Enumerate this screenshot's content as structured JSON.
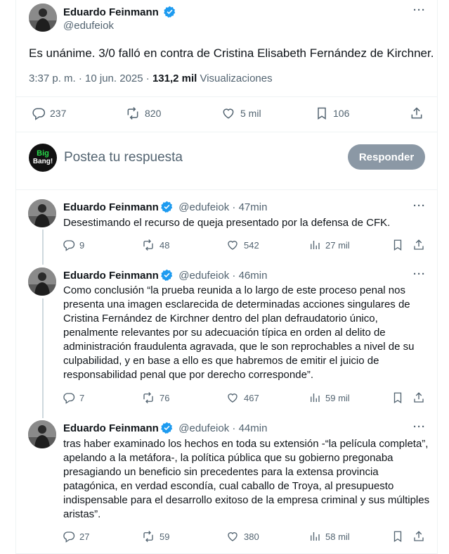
{
  "main_tweet": {
    "name": "Eduardo Feinmann",
    "handle": "@edufeiok",
    "text": "Es unánime. 3/0 falló en contra de Cristina Elisabeth Fernández de Kirchner.",
    "time": "3:37 p. m. · 10 jun. 2025 · ",
    "views_count": "131,2 mil",
    "views_label": " Visualizaciones",
    "replies": "237",
    "reposts": "820",
    "likes": "5 mil",
    "bookmarks": "106"
  },
  "composer": {
    "avatar_line1": "Big",
    "avatar_line2": "Bang!",
    "placeholder": "Postea tu respuesta",
    "button": "Responder"
  },
  "replies": [
    {
      "name": "Eduardo Feinmann",
      "handle": "@edufeiok",
      "time": "47min",
      "lines": [
        "Desestimando el recurso de queja presentado por la defensa de CFK."
      ],
      "replies": "9",
      "reposts": "48",
      "likes": "542",
      "views": "27 mil"
    },
    {
      "name": "Eduardo Feinmann",
      "handle": "@edufeiok",
      "time": "46min",
      "lines": [
        "Como conclusión “la prueba reunida a lo largo de este proceso penal nos",
        "presenta una imagen esclarecida de determinadas acciones singulares de",
        "Cristina Fernández de Kirchner dentro del plan defraudatorio único,",
        "penalmente relevantes por su adecuación típica en orden al delito de",
        "administración fraudulenta agravada, que le son reprochables a nivel de su",
        "culpabilidad, y en base a ello es que habremos de emitir el juicio de",
        "responsabilidad penal que por derecho corresponde”."
      ],
      "replies": "7",
      "reposts": "76",
      "likes": "467",
      "views": "59 mil"
    },
    {
      "name": "Eduardo Feinmann",
      "handle": "@edufeiok",
      "time": "44min",
      "lines": [
        "tras haber examinado los hechos en toda su extensión -“la película completa”,",
        "apelando a la metáfora-, la política pública que su gobierno pregonaba",
        "presagiando un beneficio sin precedentes para la extensa provincia",
        "patagónica, en verdad escondía, cual caballo de Troya, al presupuesto",
        "indispensable para el desarrollo exitoso de la empresa criminal y sus múltiples",
        "aristas”."
      ],
      "replies": "27",
      "reposts": "59",
      "likes": "380",
      "views": "58 mil"
    }
  ],
  "colors": {
    "verified": "#1d9bf0",
    "muted": "#536471",
    "button": "#8b98a5"
  }
}
